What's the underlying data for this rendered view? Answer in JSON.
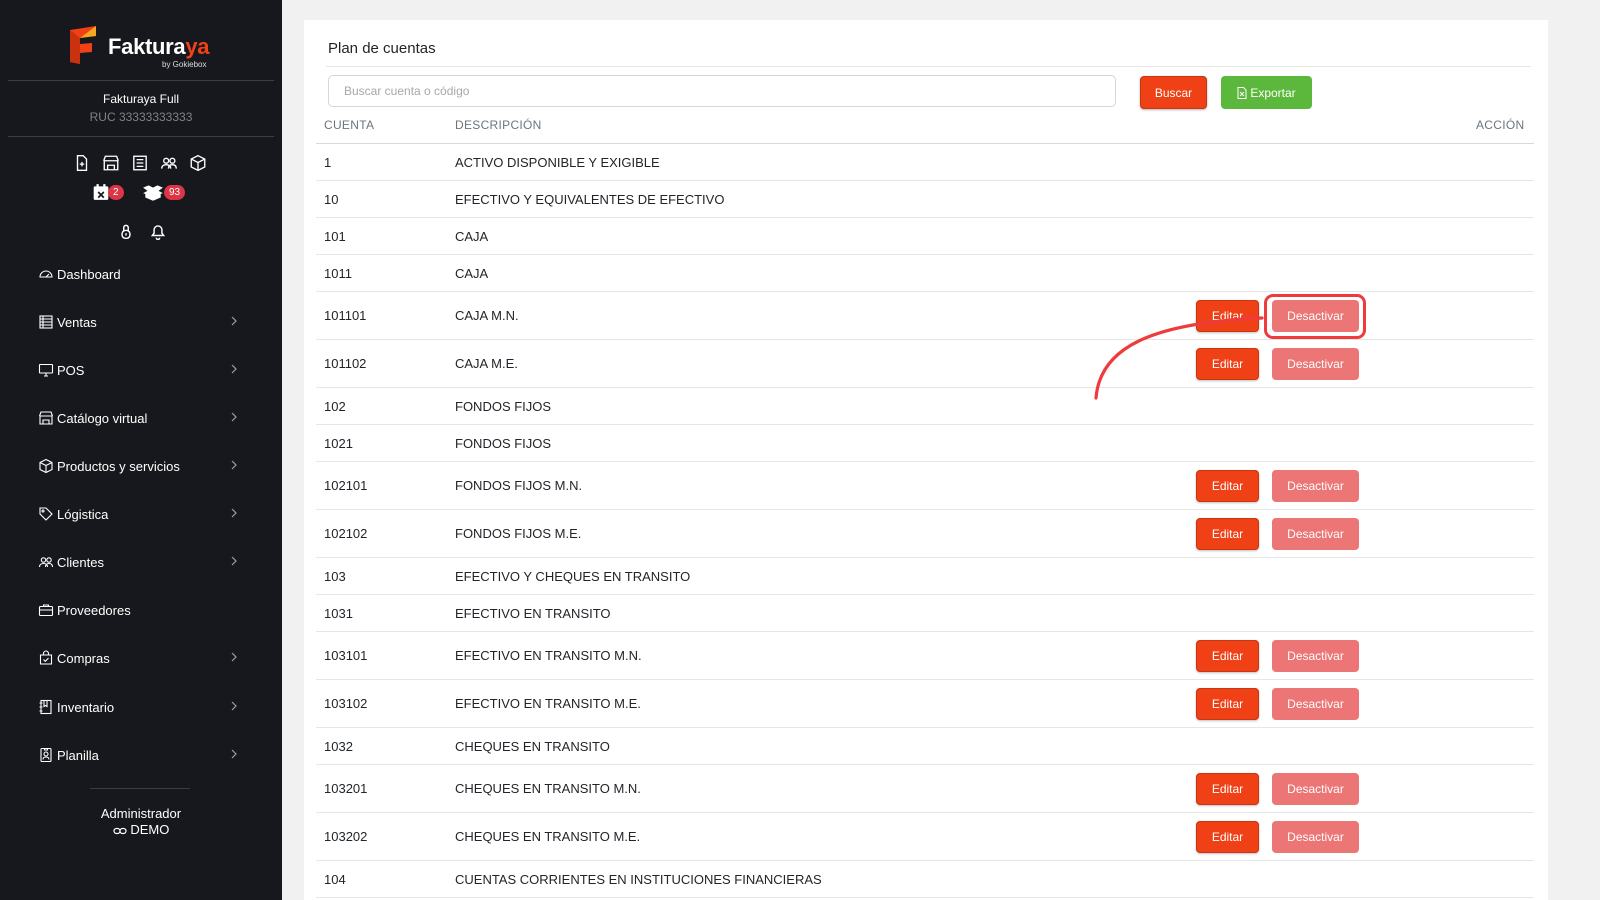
{
  "brand": {
    "name_main": "Fakturaya",
    "name_accent": "ya",
    "name_prefix": "Faktura",
    "tagline": "by Gokiebox",
    "accent_color": "#ef4016"
  },
  "company": {
    "name": "Fakturaya Full",
    "ruc": "RUC 33333333333"
  },
  "quick_icons": [
    "file-plus-icon",
    "store-icon",
    "receipt-icon",
    "users-icon",
    "box-icon"
  ],
  "badges": {
    "calendar": "2",
    "boxes": "93"
  },
  "nav": [
    {
      "label": "Dashboard",
      "icon": "speedometer-icon",
      "has_children": false
    },
    {
      "label": "Ventas",
      "icon": "ledger-icon",
      "has_children": true
    },
    {
      "label": "POS",
      "icon": "monitor-icon",
      "has_children": true
    },
    {
      "label": "Catálogo virtual",
      "icon": "shop-icon",
      "has_children": true
    },
    {
      "label": "Productos y servicios",
      "icon": "box-icon",
      "has_children": true
    },
    {
      "label": "Lógistica",
      "icon": "tag-icon",
      "has_children": true
    },
    {
      "label": "Clientes",
      "icon": "users-icon",
      "has_children": true
    },
    {
      "label": "Proveedores",
      "icon": "briefcase-icon",
      "has_children": false
    },
    {
      "label": "Compras",
      "icon": "bag-icon",
      "has_children": true
    },
    {
      "label": "Inventario",
      "icon": "journal-icon",
      "has_children": true
    },
    {
      "label": "Planilla",
      "icon": "badge-icon",
      "has_children": true
    }
  ],
  "user": {
    "role": "Administrador",
    "mode": "DEMO"
  },
  "main": {
    "title": "Plan de cuentas",
    "search_placeholder": "Buscar cuenta o código",
    "search_button": "Buscar",
    "export_button": "Exportar",
    "columns": {
      "cuenta": "CUENTA",
      "descripcion": "DESCRIPCIÓN",
      "accion": "ACCIÓN"
    },
    "edit_label": "Editar",
    "deactivate_label": "Desactivar",
    "rows": [
      {
        "cuenta": "1",
        "descripcion": "ACTIVO DISPONIBLE Y EXIGIBLE",
        "actions": false
      },
      {
        "cuenta": "10",
        "descripcion": "EFECTIVO Y EQUIVALENTES DE EFECTIVO",
        "actions": false
      },
      {
        "cuenta": "101",
        "descripcion": "CAJA",
        "actions": false
      },
      {
        "cuenta": "1011",
        "descripcion": "CAJA",
        "actions": false
      },
      {
        "cuenta": "101101",
        "descripcion": "CAJA M.N.",
        "actions": true
      },
      {
        "cuenta": "101102",
        "descripcion": "CAJA M.E.",
        "actions": true
      },
      {
        "cuenta": "102",
        "descripcion": "FONDOS FIJOS",
        "actions": false
      },
      {
        "cuenta": "1021",
        "descripcion": "FONDOS FIJOS",
        "actions": false
      },
      {
        "cuenta": "102101",
        "descripcion": "FONDOS FIJOS M.N.",
        "actions": true
      },
      {
        "cuenta": "102102",
        "descripcion": "FONDOS FIJOS M.E.",
        "actions": true
      },
      {
        "cuenta": "103",
        "descripcion": "EFECTIVO Y CHEQUES EN TRANSITO",
        "actions": false
      },
      {
        "cuenta": "1031",
        "descripcion": "EFECTIVO EN TRANSITO",
        "actions": false
      },
      {
        "cuenta": "103101",
        "descripcion": "EFECTIVO EN TRANSITO M.N.",
        "actions": true
      },
      {
        "cuenta": "103102",
        "descripcion": "EFECTIVO EN TRANSITO M.E.",
        "actions": true
      },
      {
        "cuenta": "1032",
        "descripcion": "CHEQUES EN TRANSITO",
        "actions": false
      },
      {
        "cuenta": "103201",
        "descripcion": "CHEQUES EN TRANSITO M.N.",
        "actions": true
      },
      {
        "cuenta": "103202",
        "descripcion": "CHEQUES EN TRANSITO M.E.",
        "actions": true
      },
      {
        "cuenta": "104",
        "descripcion": "CUENTAS CORRIENTES EN INSTITUCIONES FINANCIERAS",
        "actions": false
      }
    ]
  },
  "colors": {
    "sidebar_bg": "#16181d",
    "primary": "#ef4016",
    "success": "#5cb83c",
    "danger_light": "#ec7575",
    "badge": "#dc3545",
    "annotation": "#ef3b3b"
  }
}
